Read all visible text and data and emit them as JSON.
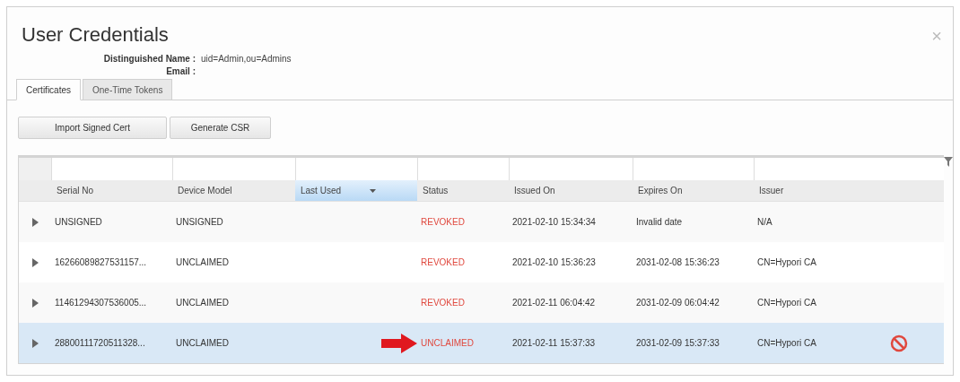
{
  "dialog": {
    "title": "User Credentials",
    "close": "×"
  },
  "fields": [
    {
      "label": "Distinguished Name :",
      "value": "uid=Admin,ou=Admins"
    },
    {
      "label": "Email :"
    }
  ],
  "tabs": [
    {
      "label": "Certificates",
      "selected": true
    },
    {
      "label": "One-Time Tokens",
      "selected": false
    }
  ],
  "buttons": [
    "Import Signed Cert",
    "Generate CSR"
  ],
  "table": {
    "columns": [
      {
        "label": "Serial No",
        "sorted": false
      },
      {
        "label": "Device Model",
        "sorted": false
      },
      {
        "label": "Last Used",
        "sorted": true
      },
      {
        "label": "Status",
        "sorted": false
      },
      {
        "label": "Issued On",
        "sorted": false
      },
      {
        "label": "Expires On",
        "sorted": false
      },
      {
        "label": "Issuer",
        "sorted": false
      }
    ],
    "rows": [
      {
        "selected": false,
        "pointer_arrow": false,
        "revoke_icon": false,
        "cells": [
          "UNSIGNED",
          "UNSIGNED",
          "",
          "REVOKED",
          "2021-02-10 15:34:34",
          "Invalid date",
          "N/A"
        ]
      },
      {
        "selected": false,
        "pointer_arrow": false,
        "revoke_icon": false,
        "cells": [
          "16266089827531157...",
          "UNCLAIMED",
          "",
          "REVOKED",
          "2021-02-10 15:36:23",
          "2031-02-08 15:36:23",
          "CN=Hypori CA"
        ]
      },
      {
        "selected": false,
        "pointer_arrow": false,
        "revoke_icon": false,
        "cells": [
          "11461294307536005...",
          "UNCLAIMED",
          "",
          "REVOKED",
          "2021-02-11 06:04:42",
          "2031-02-09 06:04:42",
          "CN=Hypori CA"
        ]
      },
      {
        "selected": true,
        "pointer_arrow": true,
        "revoke_icon": true,
        "cells": [
          "28800111720511328...",
          "UNCLAIMED",
          "",
          "UNCLAIMED",
          "2021-02-11 15:37:33",
          "2031-02-09 15:37:33",
          "CN=Hypori CA"
        ]
      }
    ]
  }
}
